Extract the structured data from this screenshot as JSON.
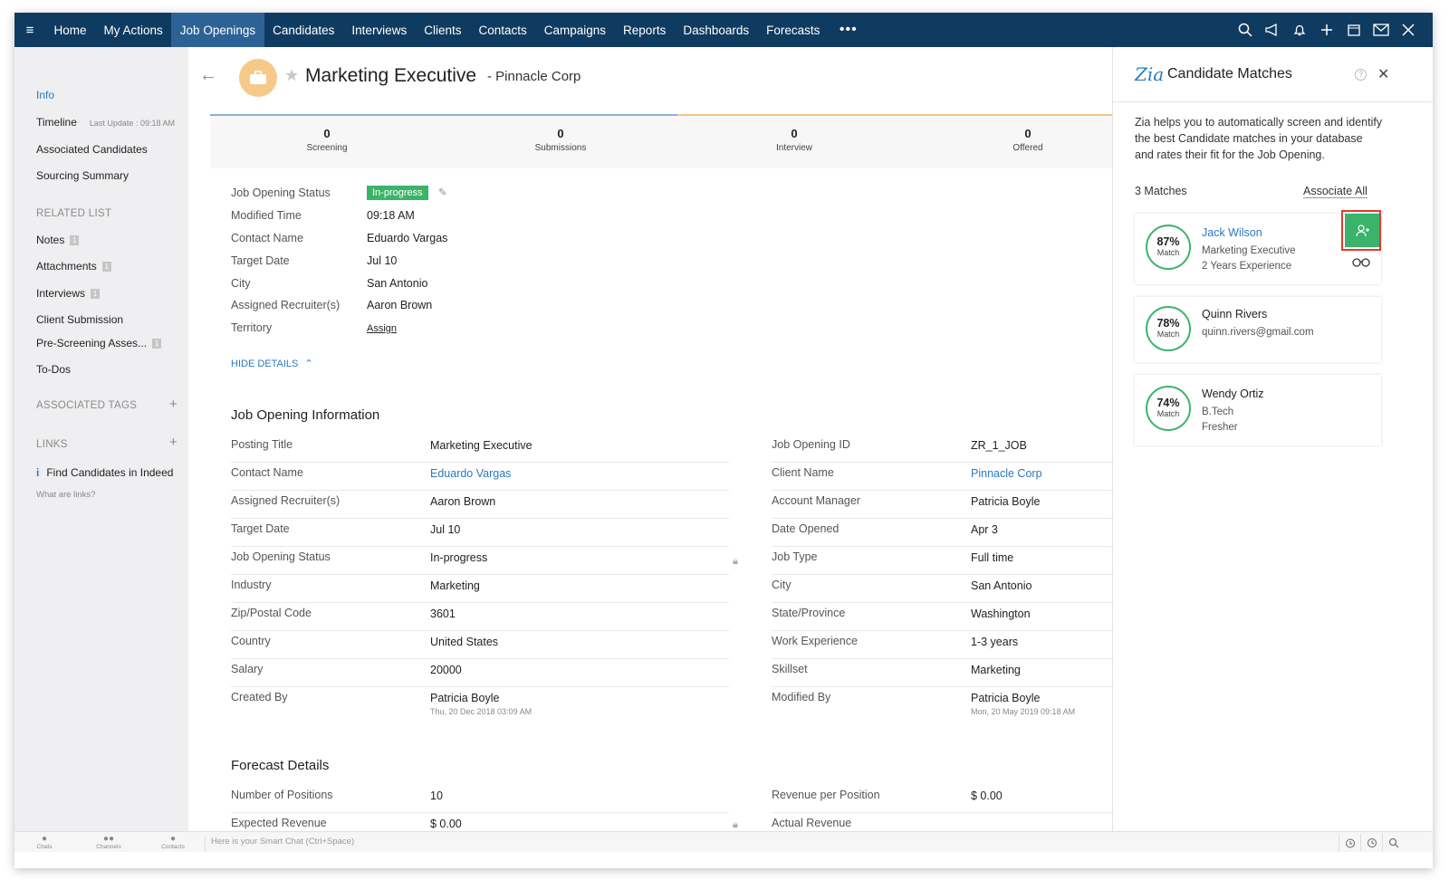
{
  "nav": {
    "tabs": [
      "Home",
      "My Actions",
      "Job Openings",
      "Candidates",
      "Interviews",
      "Clients",
      "Contacts",
      "Campaigns",
      "Reports",
      "Dashboards",
      "Forecasts"
    ],
    "active_tab": "Job Openings",
    "more": "•••",
    "right_icons": [
      "search-icon",
      "megaphone-icon",
      "bell-icon",
      "plus-icon",
      "calendar-icon",
      "mail-icon",
      "tools-icon"
    ]
  },
  "sidebar": {
    "items": [
      "Info",
      "Timeline",
      "Associated Candidates",
      "Sourcing Summary"
    ],
    "timeline_note": "Last Update : 09:18 AM",
    "related_title": "RELATED LIST",
    "related": [
      {
        "label": "Notes",
        "count": "1"
      },
      {
        "label": "Attachments",
        "count": "1"
      },
      {
        "label": "Interviews",
        "count": "1"
      },
      {
        "label": "Client Submission",
        "count": ""
      },
      {
        "label": "Pre-Screening Asses...",
        "count": "1"
      },
      {
        "label": "To-Dos",
        "count": ""
      }
    ],
    "tags_title": "ASSOCIATED TAGS",
    "links_title": "LINKS",
    "link_item": "Find Candidates in Indeed",
    "links_help": "What are links?"
  },
  "header": {
    "title": "Marketing Executive",
    "client": "- Pinnacle Corp"
  },
  "pipeline": [
    {
      "count": "0",
      "label": "Screening"
    },
    {
      "count": "0",
      "label": "Submissions"
    },
    {
      "count": "0",
      "label": "Interview"
    },
    {
      "count": "0",
      "label": "Offered"
    }
  ],
  "summary": [
    {
      "label": "Job Opening Status",
      "value": "In-progress"
    },
    {
      "label": "Modified Time",
      "value": "09:18 AM"
    },
    {
      "label": "Contact Name",
      "value": "Eduardo Vargas"
    },
    {
      "label": "Target Date",
      "value": "Jul 10"
    },
    {
      "label": "City",
      "value": "San Antonio"
    },
    {
      "label": "Assigned Recruiter(s)",
      "value": "Aaron Brown"
    },
    {
      "label": "Territory",
      "value": "Assign"
    }
  ],
  "hide_details": "HIDE DETAILS",
  "job_info": {
    "title": "Job Opening Information",
    "left": [
      {
        "label": "Posting Title",
        "value": "Marketing Executive"
      },
      {
        "label": "Contact Name",
        "value": "Eduardo Vargas"
      },
      {
        "label": "Assigned Recruiter(s)",
        "value": "Aaron Brown"
      },
      {
        "label": "Target Date",
        "value": "Jul 10"
      },
      {
        "label": "Job Opening Status",
        "value": "In-progress"
      },
      {
        "label": "Industry",
        "value": "Marketing"
      },
      {
        "label": "Zip/Postal Code",
        "value": "3601"
      },
      {
        "label": "Country",
        "value": "United States"
      },
      {
        "label": "Salary",
        "value": "20000"
      },
      {
        "label": "Created By",
        "value": "Patricia Boyle",
        "sub": "Thu, 20 Dec 2018 03:09 AM"
      }
    ],
    "right": [
      {
        "label": "Job Opening ID",
        "value": "ZR_1_JOB"
      },
      {
        "label": "Client Name",
        "value": "Pinnacle Corp"
      },
      {
        "label": "Account Manager",
        "value": "Patricia Boyle"
      },
      {
        "label": "Date Opened",
        "value": "Apr 3"
      },
      {
        "label": "Job Type",
        "value": "Full time"
      },
      {
        "label": "City",
        "value": "San Antonio"
      },
      {
        "label": "State/Province",
        "value": "Washington"
      },
      {
        "label": "Work Experience",
        "value": "1-3 years"
      },
      {
        "label": "Skillset",
        "value": "Marketing"
      },
      {
        "label": "Modified By",
        "value": "Patricia Boyle",
        "sub": "Mon, 20 May 2019 09:18 AM"
      }
    ]
  },
  "forecast": {
    "title": "Forecast Details",
    "left": [
      {
        "label": "Number of Positions",
        "value": "10"
      },
      {
        "label": "Expected Revenue",
        "value": "$ 0.00"
      }
    ],
    "right": [
      {
        "label": "Revenue per Position",
        "value": "$ 0.00"
      },
      {
        "label": "Actual Revenue",
        "value": ""
      }
    ]
  },
  "panel": {
    "title": "Candidate Matches",
    "description": "Zia helps you to automatically screen and identify the best Candidate matches in your database and rates their fit for the Job Opening.",
    "match_count": "3 Matches",
    "associate_all": "Associate All",
    "match_label": "Match",
    "candidates": [
      {
        "percent": "87%",
        "name": "Jack Wilson",
        "line1": "Marketing Executive",
        "line2": "2 Years Experience"
      },
      {
        "percent": "78%",
        "name": "Quinn Rivers",
        "line1": "quinn.rivers@gmail.com",
        "line2": ""
      },
      {
        "percent": "74%",
        "name": "Wendy Ortiz",
        "line1": "B.Tech",
        "line2": "Fresher"
      }
    ]
  },
  "footer": {
    "items": [
      "Chats",
      "Channels",
      "Contacts"
    ],
    "chat_placeholder": "Here is your Smart Chat (Ctrl+Space)"
  },
  "colors": {
    "nav_bg": "#0f3b61",
    "nav_active": "#2d6296",
    "accent_green": "#3bb36b",
    "link_blue": "#2a7ac2",
    "highlight_red": "#e03a2f"
  }
}
